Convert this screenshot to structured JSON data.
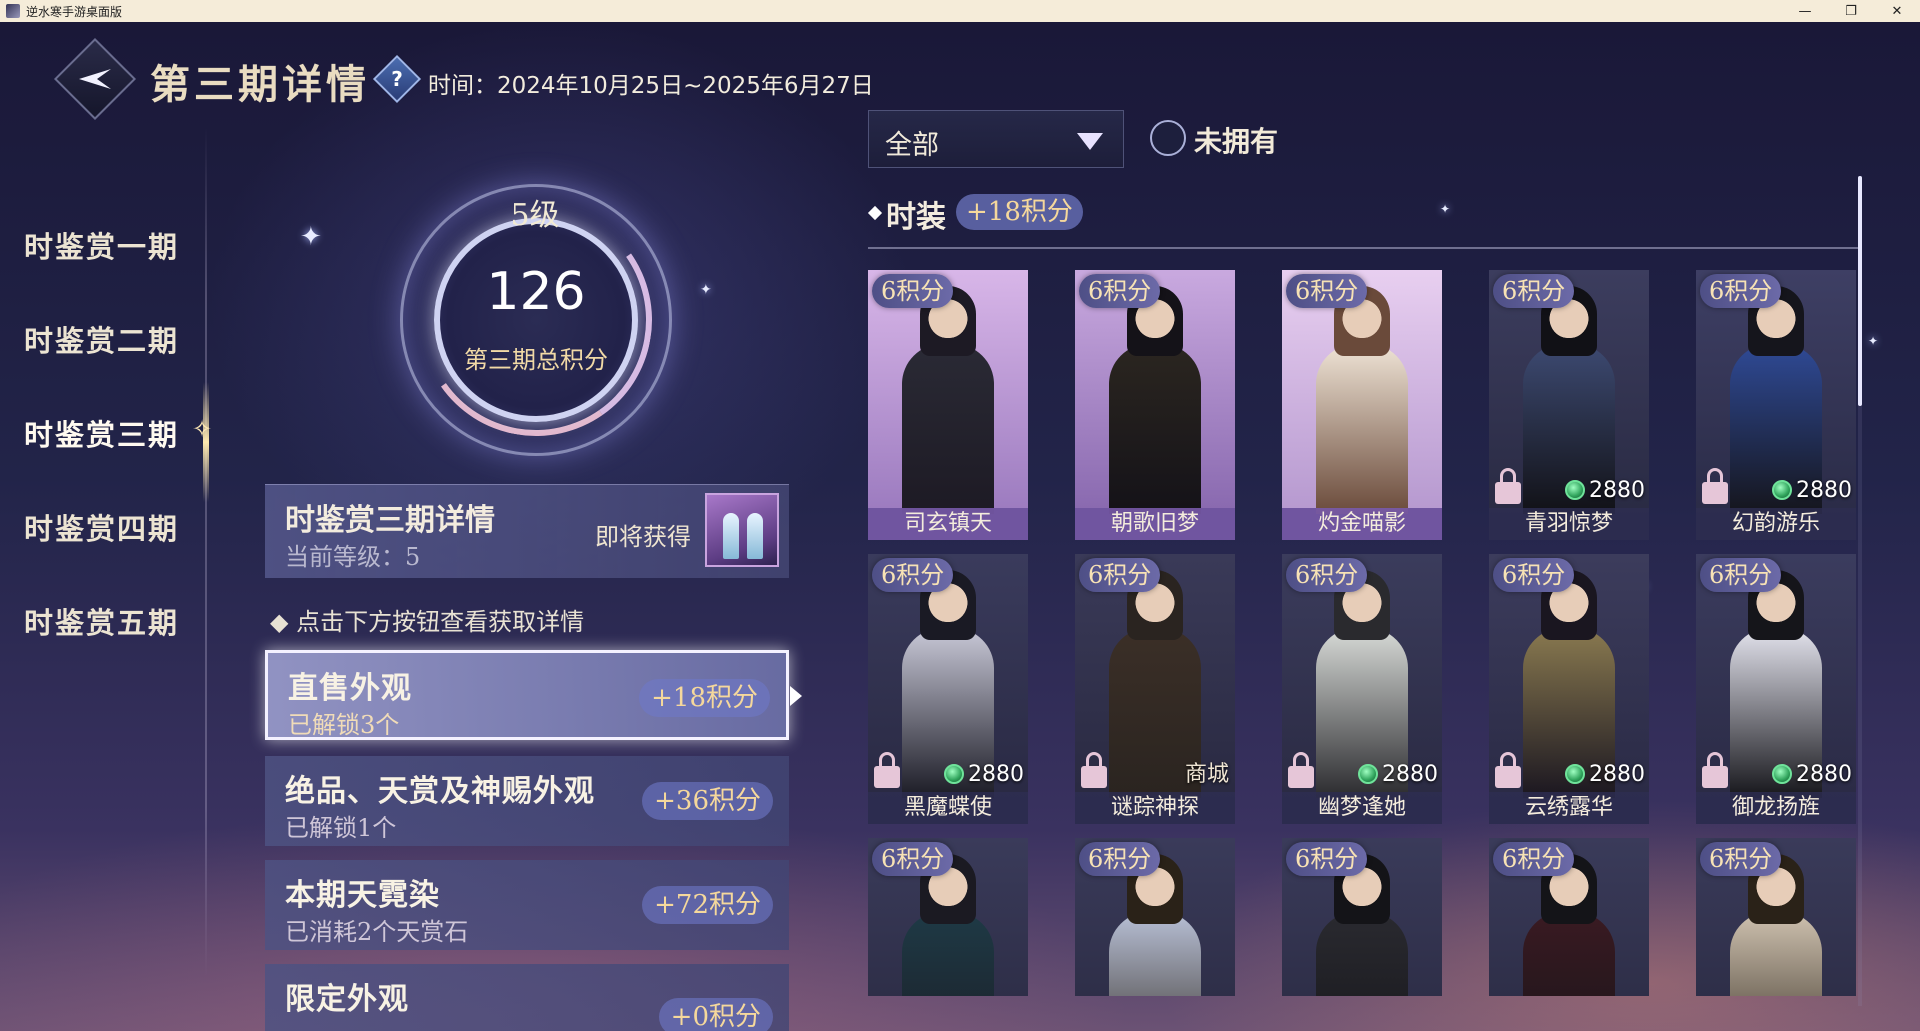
{
  "window": {
    "title": "逆水寒手游桌面版",
    "controls": [
      "—",
      "❐",
      "✕"
    ]
  },
  "header": {
    "title": "第三期详情",
    "help_icon": "?",
    "time": "时间：2024年10月25日~2025年6月27日"
  },
  "nav": {
    "items": [
      "时鉴赏一期",
      "时鉴赏二期",
      "时鉴赏三期",
      "时鉴赏四期",
      "时鉴赏五期"
    ],
    "active_index": 2
  },
  "level": {
    "level_label": "5级",
    "total_score": "126",
    "score_caption": "第三期总积分"
  },
  "detail": {
    "title": "时鉴赏三期详情",
    "current_level": "当前等级：5",
    "soon_label": "即将获得"
  },
  "hint": "点击下方按钮查看获取详情",
  "categories": [
    {
      "title": "直售外观",
      "sub": "已解锁3个",
      "bonus": "+18积分",
      "active": true
    },
    {
      "title": "绝品、天赏及神赐外观",
      "sub": "已解锁1个",
      "bonus": "+36积分",
      "active": false
    },
    {
      "title": "本期天霓染",
      "sub": "已消耗2个天赏石",
      "bonus": "+72积分",
      "active": false
    },
    {
      "title": "限定外观",
      "sub": "",
      "bonus": "+0积分",
      "active": false
    }
  ],
  "filter": {
    "selected": "全部",
    "owned_label": "未拥有"
  },
  "section": {
    "title": "时装",
    "bonus": "+18积分"
  },
  "items": [
    {
      "badge": "6积分",
      "name": "司玄镇天",
      "owned": true,
      "price": "",
      "shop": ""
    },
    {
      "badge": "6积分",
      "name": "朝歌旧梦",
      "owned": true,
      "price": "",
      "shop": ""
    },
    {
      "badge": "6积分",
      "name": "灼金喵影",
      "owned": true,
      "price": "",
      "shop": ""
    },
    {
      "badge": "6积分",
      "name": "青羽惊梦",
      "owned": false,
      "price": "2880",
      "shop": ""
    },
    {
      "badge": "6积分",
      "name": "幻韵游乐",
      "owned": false,
      "price": "2880",
      "shop": ""
    },
    {
      "badge": "6积分",
      "name": "黑魔蝶使",
      "owned": false,
      "price": "2880",
      "shop": ""
    },
    {
      "badge": "6积分",
      "name": "谜踪神探",
      "owned": false,
      "price": "",
      "shop": "商城"
    },
    {
      "badge": "6积分",
      "name": "幽梦逢她",
      "owned": false,
      "price": "2880",
      "shop": ""
    },
    {
      "badge": "6积分",
      "name": "云绣露华",
      "owned": false,
      "price": "2880",
      "shop": ""
    },
    {
      "badge": "6积分",
      "name": "御龙扬旌",
      "owned": false,
      "price": "2880",
      "shop": ""
    },
    {
      "badge": "6积分",
      "name": "",
      "owned": false,
      "price": "",
      "shop": ""
    },
    {
      "badge": "6积分",
      "name": "",
      "owned": false,
      "price": "",
      "shop": ""
    },
    {
      "badge": "6积分",
      "name": "",
      "owned": false,
      "price": "",
      "shop": ""
    },
    {
      "badge": "6积分",
      "name": "",
      "owned": false,
      "price": "",
      "shop": ""
    },
    {
      "badge": "6积分",
      "name": "",
      "owned": false,
      "price": "",
      "shop": ""
    }
  ],
  "colors": {
    "accent_gold": "#f5d89c",
    "owned_strip": "#7a5aaa",
    "jade": "#2fa35b"
  }
}
